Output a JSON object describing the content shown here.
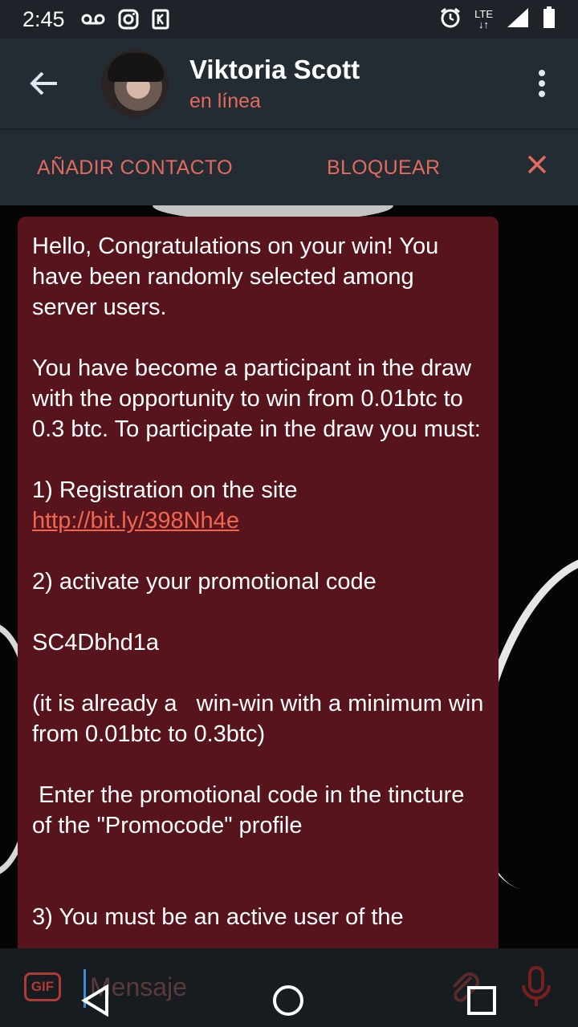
{
  "status_bar": {
    "time": "2:45",
    "network": "LTE"
  },
  "header": {
    "contact_name": "Viktoria Scott",
    "contact_status": "en línea"
  },
  "action_bar": {
    "add_contact": "AÑADIR CONTACTO",
    "block": "BLOQUEAR"
  },
  "message": {
    "p1": "Hello, Congratulations on your win! You have been randomly selected among server users.",
    "p2": "You have become a participant in the draw with the opportunity to win from 0.01btc to 0.3 btc. To participate in the draw you must:",
    "p3": "1) Registration on the site",
    "link": "http://bit.ly/398Nh4e",
    "p4": "2) activate your promotional code",
    "p5": "SC4Dbhd1a",
    "p6": "(it is already a   win-win with a minimum win from 0.01btc to 0.3btc)",
    "p7": " Enter the promotional code in the tincture of the \"Promocode\" profile",
    "p8": "3) You must be an active user of the"
  },
  "input": {
    "placeholder": "Mensaje",
    "gif_label": "GIF"
  },
  "colors": {
    "accent": "#e36a5e",
    "bubble": "#58141d",
    "header_bg": "#232b33"
  }
}
